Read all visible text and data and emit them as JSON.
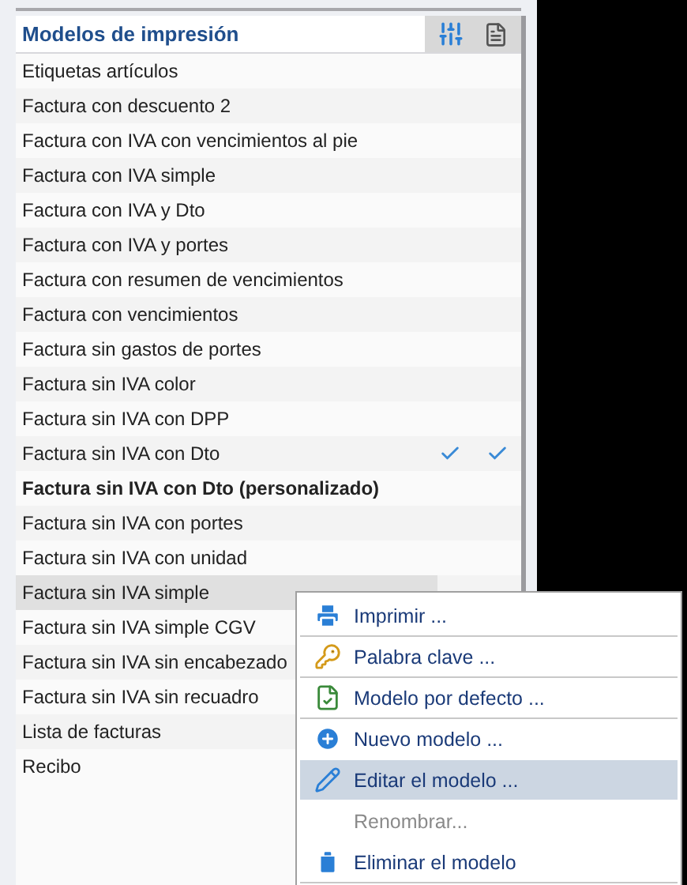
{
  "panel": {
    "title": "Modelos de impresión"
  },
  "rows": [
    {
      "label": "Etiquetas artículos",
      "bold": false,
      "selected": false,
      "option_checked": false,
      "document_checked": false
    },
    {
      "label": "Factura con descuento 2",
      "bold": false,
      "selected": false,
      "option_checked": false,
      "document_checked": false
    },
    {
      "label": "Factura con IVA con vencimientos al pie",
      "bold": false,
      "selected": false,
      "option_checked": false,
      "document_checked": false
    },
    {
      "label": "Factura con IVA simple",
      "bold": false,
      "selected": false,
      "option_checked": false,
      "document_checked": false
    },
    {
      "label": "Factura con IVA y Dto",
      "bold": false,
      "selected": false,
      "option_checked": false,
      "document_checked": false
    },
    {
      "label": "Factura con IVA y portes",
      "bold": false,
      "selected": false,
      "option_checked": false,
      "document_checked": false
    },
    {
      "label": "Factura con resumen de vencimientos",
      "bold": false,
      "selected": false,
      "option_checked": false,
      "document_checked": false
    },
    {
      "label": "Factura con vencimientos",
      "bold": false,
      "selected": false,
      "option_checked": false,
      "document_checked": false
    },
    {
      "label": "Factura sin gastos de portes",
      "bold": false,
      "selected": false,
      "option_checked": false,
      "document_checked": false
    },
    {
      "label": "Factura sin IVA color",
      "bold": false,
      "selected": false,
      "option_checked": false,
      "document_checked": false
    },
    {
      "label": "Factura sin IVA con DPP",
      "bold": false,
      "selected": false,
      "option_checked": false,
      "document_checked": false
    },
    {
      "label": "Factura sin IVA con Dto",
      "bold": false,
      "selected": false,
      "option_checked": true,
      "document_checked": true
    },
    {
      "label": "Factura sin IVA con Dto (personalizado)",
      "bold": true,
      "selected": false,
      "option_checked": false,
      "document_checked": false
    },
    {
      "label": "Factura sin IVA con portes",
      "bold": false,
      "selected": false,
      "option_checked": false,
      "document_checked": false
    },
    {
      "label": "Factura sin IVA con unidad",
      "bold": false,
      "selected": false,
      "option_checked": false,
      "document_checked": false
    },
    {
      "label": "Factura sin IVA simple",
      "bold": false,
      "selected": true,
      "option_checked": false,
      "document_checked": false
    },
    {
      "label": "Factura sin IVA simple CGV",
      "bold": false,
      "selected": false,
      "option_checked": false,
      "document_checked": false
    },
    {
      "label": "Factura sin IVA sin encabezado",
      "bold": false,
      "selected": false,
      "option_checked": false,
      "document_checked": false
    },
    {
      "label": "Factura sin IVA sin recuadro",
      "bold": false,
      "selected": false,
      "option_checked": false,
      "document_checked": false
    },
    {
      "label": "Lista de facturas",
      "bold": false,
      "selected": false,
      "option_checked": false,
      "document_checked": false
    },
    {
      "label": "Recibo",
      "bold": false,
      "selected": false,
      "option_checked": false,
      "document_checked": false
    }
  ],
  "context_menu": [
    {
      "label": "Imprimir ...",
      "kind": "print",
      "selected": false,
      "disabled": false,
      "separator_after": true
    },
    {
      "label": "Palabra clave ...",
      "kind": "key",
      "selected": false,
      "disabled": false,
      "separator_after": true
    },
    {
      "label": "Modelo por defecto ...",
      "kind": "default",
      "selected": false,
      "disabled": false,
      "separator_after": true
    },
    {
      "label": "Nuevo modelo ...",
      "kind": "new",
      "selected": false,
      "disabled": false,
      "separator_after": false
    },
    {
      "label": "Editar el modelo ...",
      "kind": "edit",
      "selected": true,
      "disabled": false,
      "separator_after": false
    },
    {
      "label": "Renombrar...",
      "kind": "none",
      "selected": false,
      "disabled": true,
      "separator_after": false
    },
    {
      "label": "Eliminar el modelo",
      "kind": "delete",
      "selected": false,
      "disabled": false,
      "separator_after": true
    }
  ]
}
